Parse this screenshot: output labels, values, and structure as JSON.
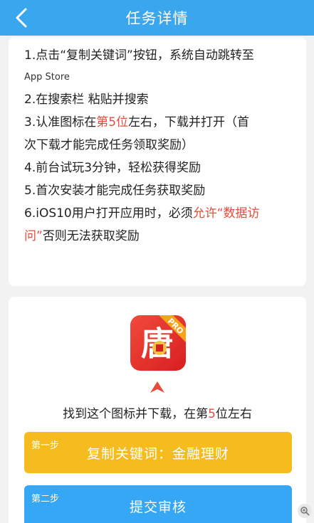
{
  "header": {
    "title": "任务详情",
    "back_icon": "chevron-left-icon"
  },
  "instructions": {
    "line1a": "1.点击“复制关键词”按钮，系统自动跳转至",
    "line1b": "App Store",
    "line2": "2.在搜索栏 粘贴并搜索",
    "line3_pre": "3.认准图标在",
    "line3_red": "第5位",
    "line3_post": "左右，下载并打开（首",
    "line3b": "次下载才能完成任务领取奖励）",
    "line4": "4.前台试玩3分钟，轻松获得奖励",
    "line5": "5.首次安装才能完成任务获取奖励",
    "line6_pre": "6.iOS10用户打开应用时，必须",
    "line6_red": "允许“数据访",
    "line6b_red": "问”",
    "line6b_post": "否则无法获取奖励"
  },
  "app": {
    "icon_char": "唐",
    "badge": "PRO",
    "colors": {
      "icon": "#e0281f",
      "badge": "#f7a31a",
      "coin": "#f5c242"
    }
  },
  "find": {
    "pre": "找到这个图标并下载，在第",
    "num": "5",
    "post": "位左右"
  },
  "steps": [
    {
      "label": "第一步",
      "text": "复制关键词：金融理财",
      "color": "#f6bb1f"
    },
    {
      "label": "第二步",
      "text": "提交审核",
      "color": "#35a7f4"
    }
  ],
  "colors": {
    "header": "#3aa6ee",
    "accent_red": "#e84a3c"
  }
}
